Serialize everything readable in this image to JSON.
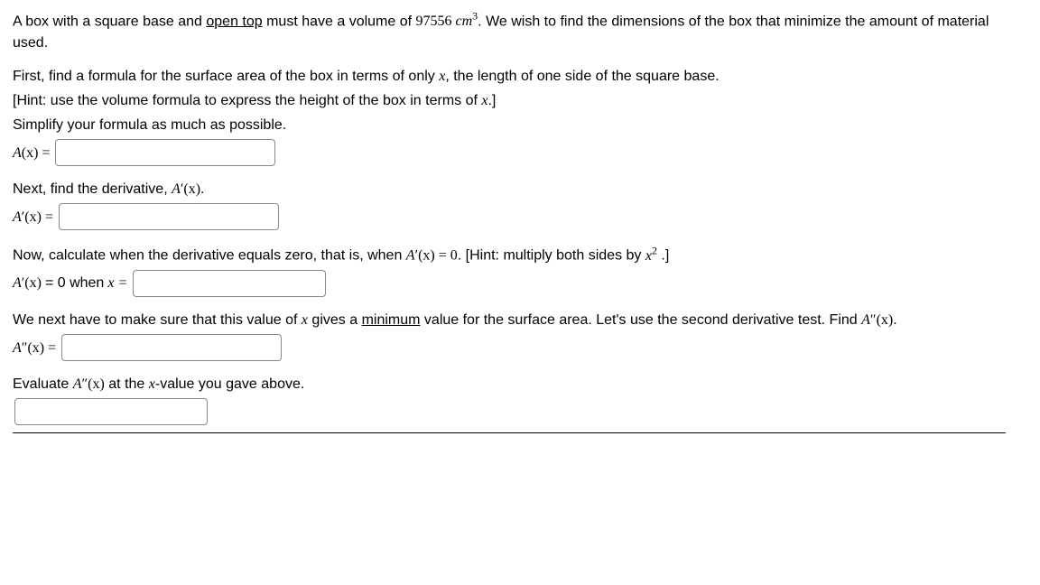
{
  "intro": {
    "p1_pre": "A box with a square base and ",
    "p1_open_top": "open top",
    "p1_mid": " must have a volume of ",
    "volume_val": "97556",
    "volume_unit_base": "cm",
    "volume_unit_sup": "3",
    "p1_post": ". We wish to find the dimensions of the box that minimize the amount of material used."
  },
  "step1": {
    "p1": "First, find a formula for the surface area of the box in terms of only ",
    "var1": "x",
    "p1b": ", the length of one side of the square base.",
    "hint_pre": "[Hint: use the volume formula to express the height of the box in terms of ",
    "hint_var": "x",
    "hint_post": ".]",
    "p2": "Simplify your formula as much as possible.",
    "label_A": "A",
    "label_paren_x": "(x)",
    "eq": " = "
  },
  "step2": {
    "p1": "Next, find the derivative, ",
    "expr_A": "A",
    "expr_prime": "′",
    "expr_px": "(x)",
    "p1b": ".",
    "label_A": "A",
    "label_prime": "′",
    "label_px": "(x)",
    "eq": " = "
  },
  "step3": {
    "p1": "Now, calculate when the derivative equals zero, that is, when ",
    "expr_A": "A",
    "expr_prime": "′",
    "expr_px": "(x)",
    "expr_eq0": " = 0",
    "p1b": ". [Hint: multiply both sides by ",
    "hint_x": "x",
    "hint_sup": "2",
    "p1c": " .]",
    "label_A": "A",
    "label_prime": "′",
    "label_px": "(x)",
    "label_rest": " = 0 when ",
    "label_x": "x",
    "label_eq": " = "
  },
  "step4": {
    "p1a": "We next have to make sure that this value of ",
    "var_x": "x",
    "p1b": " gives a ",
    "min_word": "minimum",
    "p1c": " value for the surface area. Let's use the second derivative test. Find ",
    "expr_A": "A",
    "expr_pp": "″",
    "expr_px": "(x)",
    "p1d": ".",
    "label_A": "A",
    "label_pp": "″",
    "label_px": "(x)",
    "eq": " = "
  },
  "step5": {
    "p1a": "Evaluate ",
    "expr_A": "A",
    "expr_pp": "″",
    "expr_px": "(x)",
    "p1b": " at the ",
    "var_x": "x",
    "p1c": "-value you gave above."
  }
}
